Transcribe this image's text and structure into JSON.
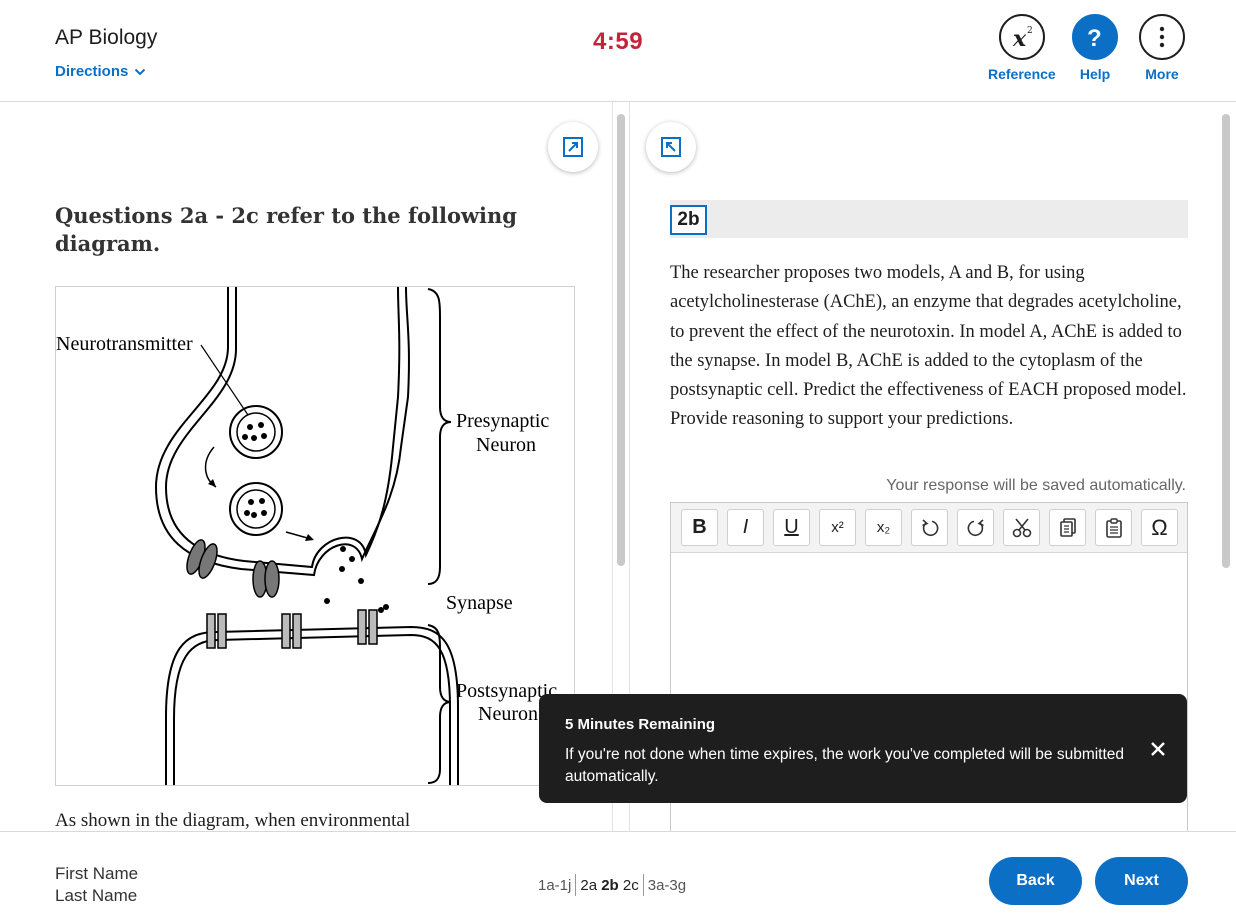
{
  "header": {
    "app_title": "AP Biology",
    "directions_label": "Directions",
    "timer": "4:59",
    "tools": [
      {
        "label": "Reference",
        "icon": "formula-icon"
      },
      {
        "label": "Help",
        "icon": "question-mark-icon"
      },
      {
        "label": "More",
        "icon": "vertical-ellipsis-icon"
      }
    ]
  },
  "left_pane": {
    "heading": "Questions 2a - 2c refer to the following diagram.",
    "diagram_labels": {
      "neurotransmitter": "Neurotransmitter",
      "presynaptic_1": "Presynaptic",
      "presynaptic_2": "Neuron",
      "synapse": "Synapse",
      "postsynaptic_1": "Postsynaptic",
      "postsynaptic_2": "Neuron"
    },
    "trailing_text": "As shown in the diagram, when environmental"
  },
  "right_pane": {
    "question_label": "2b",
    "prompt": "The researcher proposes two models, A and B, for using acetylcholinesterase (AChE), an enzyme that degrades acetylcholine, to prevent the effect of the neurotoxin. In model A, AChE is added to the synapse.  In model B, AChE is added to the cytoplasm of the postsynaptic cell. Predict the effectiveness of EACH proposed model. Provide reasoning to support your predictions.",
    "autosave_text": "Your response will be saved automatically.",
    "editor_value": "",
    "toolbar": {
      "bold": "B",
      "italic": "I",
      "underline": "U",
      "superscript": "x²",
      "subscript": "x₂",
      "special_char": "Ω"
    }
  },
  "toast": {
    "title": "5 Minutes Remaining",
    "body": "If you're not done when time expires, the work you've completed will be submitted automatically."
  },
  "footer": {
    "first_name": "First Name",
    "last_name": "Last Name",
    "nav": {
      "prev_group": "1a-1j",
      "current_a": "2a",
      "current_b": "2b",
      "current_c": "2c",
      "next_group": "3a-3g"
    },
    "back_label": "Back",
    "next_label": "Next"
  },
  "colors": {
    "accent": "#0b6fc6",
    "timer": "#c2243b",
    "toast_bg": "#1e1e1e"
  }
}
